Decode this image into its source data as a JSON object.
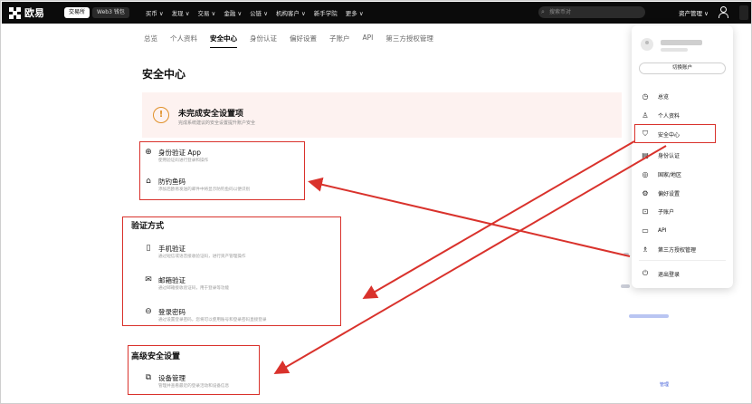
{
  "nav": {
    "logo": "欧易",
    "pill_exchange": "交易所",
    "pill_web3": "Web3 钱包",
    "menu": [
      "买币 ∨",
      "发现 ∨",
      "交易 ∨",
      "金融 ∨",
      "公链 ∨",
      "机构客户 ∨",
      "新手学院",
      "更多 ∨"
    ],
    "search_placeholder": "搜索币对",
    "asset_menu": "资产管理 ∨"
  },
  "tabs": [
    "总览",
    "个人资料",
    "安全中心",
    "身份认证",
    "偏好设置",
    "子账户",
    "API",
    "第三方授权管理"
  ],
  "page_title": "安全中心",
  "warning": {
    "title": "未完成安全设置项",
    "subtitle": "完成系统建议的安全设置提升账户安全"
  },
  "incomplete": [
    {
      "title": "身份验证 App",
      "sub": "使用验证码进行登录和操作"
    },
    {
      "title": "防钓鱼码",
      "sub": "添加后欧易发送的邮件中将显示防钓鱼码以便识别"
    }
  ],
  "verify_section": "验证方式",
  "verify_items": [
    {
      "title": "手机验证",
      "sub": "通过短信或语音接收验证码，进行资产管理操作"
    },
    {
      "title": "邮箱验证",
      "sub": "通过邮箱接收验证码，用于登录等功能"
    },
    {
      "title": "登录密码",
      "sub": "通过设置登录密码，您将可以使用账号和登录密码直接登录"
    }
  ],
  "advanced_section": "高级安全设置",
  "advanced_items": [
    {
      "title": "设备管理",
      "sub": "管理并查看最近的登录活动和设备信息"
    }
  ],
  "manage_label": "管理",
  "dropdown": {
    "switch_account": "切换账户",
    "items": [
      {
        "icon": "clock-icon",
        "label": "总览"
      },
      {
        "icon": "person-icon",
        "label": "个人资料"
      },
      {
        "icon": "shield-icon",
        "label": "安全中心"
      },
      {
        "icon": "id-card-icon",
        "label": "身份认证"
      },
      {
        "icon": "globe-icon",
        "label": "国家/地区"
      },
      {
        "icon": "gear-icon",
        "label": "偏好设置"
      },
      {
        "icon": "sub-account-icon",
        "label": "子账户"
      },
      {
        "icon": "api-icon",
        "label": "API"
      },
      {
        "icon": "third-party-icon",
        "label": "第三方授权管理"
      },
      {
        "icon": "power-icon",
        "label": "退出登录"
      }
    ]
  },
  "colors": {
    "annotation_red": "#d9322c",
    "warning_orange": "#e0912a",
    "link_blue": "#3d5bd8"
  }
}
